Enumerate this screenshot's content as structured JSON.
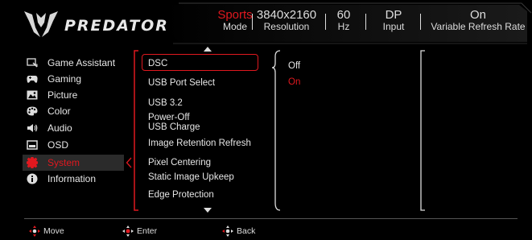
{
  "header": {
    "brand": "PREDATOR",
    "stats": [
      {
        "value": "Sports",
        "label": "Mode"
      },
      {
        "value": "3840x2160",
        "label": "Resolution"
      },
      {
        "value": "60",
        "label": "Hz"
      },
      {
        "value": "DP",
        "label": "Input"
      },
      {
        "value": "On",
        "label": "Variable Refresh Rate"
      }
    ]
  },
  "menu": {
    "items": [
      {
        "label": "Game Assistant",
        "icon": "game-assistant-icon"
      },
      {
        "label": "Gaming",
        "icon": "gamepad-icon"
      },
      {
        "label": "Picture",
        "icon": "picture-icon"
      },
      {
        "label": "Color",
        "icon": "palette-icon"
      },
      {
        "label": "Audio",
        "icon": "speaker-icon"
      },
      {
        "label": "OSD",
        "icon": "osd-icon"
      },
      {
        "label": "System",
        "icon": "gear-icon",
        "active": true
      },
      {
        "label": "Information",
        "icon": "info-icon"
      }
    ]
  },
  "submenu": {
    "items": [
      {
        "label": "DSC",
        "selected": true
      },
      {
        "label": "USB Port Select"
      },
      {
        "label": "USB 3.2"
      },
      {
        "label": "Power-Off\nUSB Charge"
      },
      {
        "label": "Image Retention Refresh"
      },
      {
        "label": "Pixel Centering"
      },
      {
        "label": "Static Image Upkeep"
      },
      {
        "label": "Edge Protection"
      }
    ]
  },
  "options": {
    "items": [
      {
        "label": "Off"
      },
      {
        "label": "On",
        "current": true
      }
    ]
  },
  "footer": {
    "move": "Move",
    "enter": "Enter",
    "back": "Back"
  },
  "colors": {
    "accent": "#e0181f",
    "text": "#e6e6e6",
    "background": "#000000",
    "active_bg": "#2b2b2b"
  }
}
